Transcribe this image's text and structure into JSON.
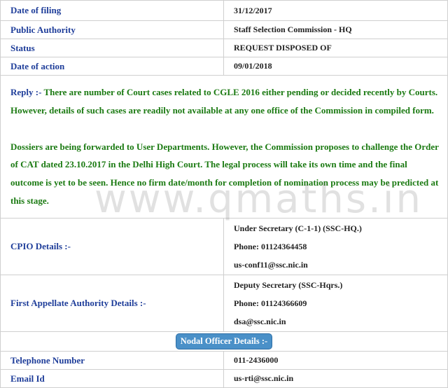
{
  "rows": {
    "date_of_filing": {
      "label": "Date of filing",
      "value": "31/12/2017"
    },
    "public_authority": {
      "label": "Public Authority",
      "value": "Staff Selection Commission - HQ"
    },
    "status": {
      "label": "Status",
      "value": "REQUEST DISPOSED OF"
    },
    "date_of_action": {
      "label": "Date of action",
      "value": "09/01/2018"
    }
  },
  "reply": {
    "keyword": "Reply :-",
    "para1": "There are number of Court cases related to CGLE 2016 either pending or decided recently by Courts. However, details of such cases are readily not available at any one office of the Commission in compiled form.",
    "para2": "Dossiers are being forwarded to User Departments. However, the Commission proposes to challenge the Order of CAT dated 23.10.2017 in the Delhi High Court. The legal process will take its own time and the final outcome is yet to be seen. Hence no firm date/month for completion of nomination process may be predicted at this stage."
  },
  "cpio": {
    "label": "CPIO Details :-",
    "designation": "Under Secretary (C-1-1) (SSC-HQ.)",
    "phone": "Phone: 01124364458",
    "email": "us-conf11@ssc.nic.in"
  },
  "faa": {
    "label": "First Appellate Authority Details :-",
    "designation": "Deputy Secretary (SSC-Hqrs.)",
    "phone": "Phone: 01124366609",
    "email": "dsa@ssc.nic.in"
  },
  "nodal": {
    "heading": "Nodal Officer Details :-",
    "telephone_label": "Telephone Number",
    "telephone_value": "011-2436000",
    "email_label": "Email Id",
    "email_value": "us-rti@ssc.nic.in"
  },
  "watermark": "www.qmaths.in"
}
